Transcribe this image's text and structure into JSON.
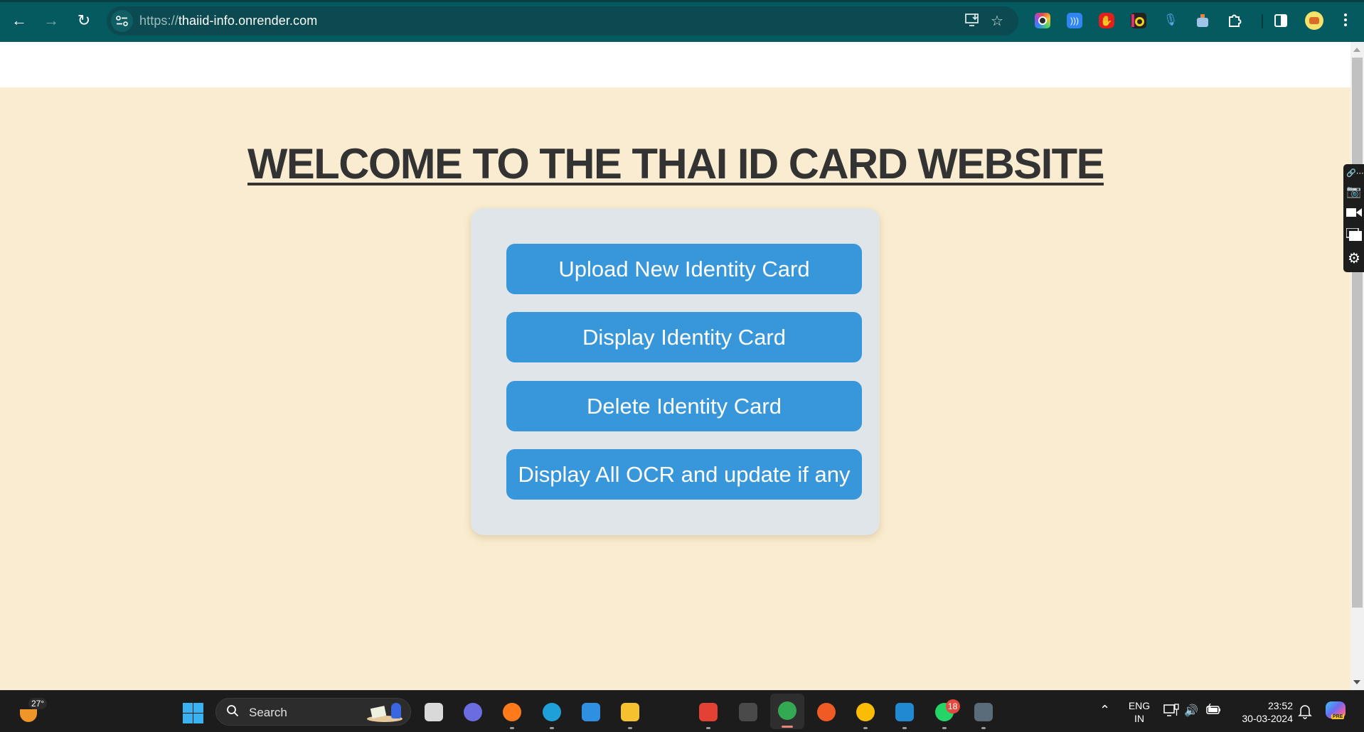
{
  "browser": {
    "url_scheme": "https://",
    "url_host": "thaiid-info.onrender.com",
    "nav": {
      "back_icon": "arrow-left-icon",
      "forward_icon": "arrow-right-icon",
      "reload_icon": "reload-icon"
    },
    "address_bar_icons": [
      "install-app-icon",
      "bookmark-star-icon"
    ],
    "extensions": [
      {
        "name": "camera-extension-icon",
        "color": "#2a2a2a"
      },
      {
        "name": "audio-extension-icon",
        "color": "#2f86f0"
      },
      {
        "name": "adblock-extension-icon",
        "color": "#e0201d"
      },
      {
        "name": "medal-extension-icon",
        "color": "#f1d31b"
      },
      {
        "name": "microphone-extension-icon",
        "color": "#5aa6e6"
      },
      {
        "name": "perfume-extension-icon",
        "color": "#9ec4e8"
      },
      {
        "name": "extensions-puzzle-icon",
        "color": "#ffffff"
      }
    ]
  },
  "page": {
    "heading": "WELCOME TO THE THAI ID CARD WEBSITE",
    "buttons": [
      {
        "label": "Upload New Identity Card"
      },
      {
        "label": "Display Identity Card"
      },
      {
        "label": "Delete Identity Card"
      },
      {
        "label": "Display All OCR and update if any"
      }
    ],
    "colors": {
      "background": "#f9ecd0",
      "card": "#dfe5e9",
      "button": "#3897db",
      "heading": "#333333"
    }
  },
  "capture_toolbar": {
    "items": [
      "link-more-icon",
      "camera-icon",
      "video-icon",
      "window-icon",
      "settings-gear-icon"
    ]
  },
  "taskbar": {
    "weather_temp": "27°",
    "search_label": "Search",
    "apps": [
      {
        "name": "task-view-icon",
        "color": "#d9d9d9",
        "running": false
      },
      {
        "name": "teams-icon",
        "color": "#6a6ce0",
        "running": false
      },
      {
        "name": "firefox-icon",
        "color": "#ff7a1a",
        "running": true
      },
      {
        "name": "edge-icon",
        "color": "#1fa0d8",
        "running": true
      },
      {
        "name": "mail-icon",
        "color": "#2f8fe0",
        "running": false
      },
      {
        "name": "file-explorer-icon",
        "color": "#f5c12e",
        "running": true
      },
      {
        "name": "dell-icon",
        "color": "#1c1c1c",
        "running": false
      },
      {
        "name": "gmail-icon",
        "color": "#e34133",
        "running": true
      },
      {
        "name": "app-tile-icon",
        "color": "#4a4a4a",
        "running": false
      },
      {
        "name": "chrome-profile-icon",
        "color": "#34a853",
        "running": true,
        "active": true
      },
      {
        "name": "brave-icon",
        "color": "#f05a24",
        "running": false
      },
      {
        "name": "chrome-icon",
        "color": "#fbbc05",
        "running": true
      },
      {
        "name": "vscode-icon",
        "color": "#1f8ad2",
        "running": true
      },
      {
        "name": "whatsapp-icon",
        "color": "#25d366",
        "running": true,
        "badge": "18"
      },
      {
        "name": "calculator-icon",
        "color": "#5a6b7a",
        "running": true
      }
    ],
    "language_line1": "ENG",
    "language_line2": "IN",
    "time": "23:52",
    "date": "30-03-2024"
  }
}
